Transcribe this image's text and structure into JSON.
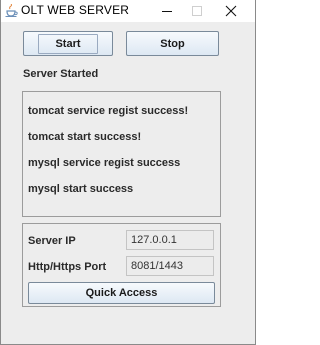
{
  "window": {
    "title": "OLT WEB SERVER",
    "icon": "java-cup-icon",
    "controls": {
      "minimize": "minimize-icon",
      "maximize": "maximize-icon",
      "close": "close-icon"
    }
  },
  "toolbar": {
    "start_label": "Start",
    "stop_label": "Stop"
  },
  "status": "Server Started",
  "log": [
    "tomcat service regist success!",
    "tomcat start success!",
    "mysql service regist success",
    "mysql start success"
  ],
  "info": {
    "server_ip_label": "Server IP",
    "server_ip_value": "127.0.0.1",
    "port_label": "Http/Https Port",
    "port_value": "8081/1443",
    "quick_access_label": "Quick Access"
  },
  "colors": {
    "client_bg": "#ededed",
    "button_gradient_top": "#f7fafd",
    "button_gradient_bottom": "#dde8f3",
    "field_bg": "#ececec"
  }
}
